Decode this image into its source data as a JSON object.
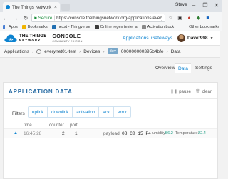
{
  "browser": {
    "tab_title": "The Things Network Co",
    "tab_close": "×",
    "profile": "Steve",
    "win_min": "–",
    "win_max": "❐",
    "win_close": "✕",
    "secure_label": "Secure",
    "url": "https://console.thethingsnetwork.org/applications/everynet01-test/dev...",
    "bookmarks": [
      {
        "label": "Apps"
      },
      {
        "label": "Bookmarks"
      },
      {
        "label": "nexxt - Thingverse"
      },
      {
        "label": "Online regex tester a"
      },
      {
        "label": "Activation Lock"
      }
    ],
    "other_bookmarks": "Other bookmarks"
  },
  "header": {
    "logo_line1": "THE THINGS",
    "logo_line2": "NETWORK",
    "console": "CONSOLE",
    "console_sub": "COMMUNITY EDITION",
    "nav_applications": "Applications",
    "nav_gateways": "Gateways",
    "user": "Davet998"
  },
  "breadcrumb": {
    "applications": "Applications",
    "app": "everynet01-test",
    "devices": "Devices",
    "dev_badge": "dev",
    "device_id": "000000000395b4bfe",
    "data": "Data"
  },
  "tabs": {
    "overview": "Overview",
    "data": "Data",
    "settings": "Settings"
  },
  "card": {
    "title": "APPLICATION DATA",
    "pause": "pause",
    "clear": "clear",
    "filters_label": "Filters",
    "filters": [
      "uplink",
      "downlink",
      "activation",
      "ack",
      "error"
    ],
    "columns": {
      "time": "time",
      "counter": "counter",
      "port": "port"
    },
    "rows": [
      {
        "time": "16:45:28",
        "counter": "2",
        "port": "1",
        "payload_label": "payload:",
        "payload": "08 C0 15 F4",
        "humidity_label": "Humidity:",
        "humidity": "56.2",
        "temperature_label": "Temperature:",
        "temperature": "22.4"
      }
    ]
  }
}
